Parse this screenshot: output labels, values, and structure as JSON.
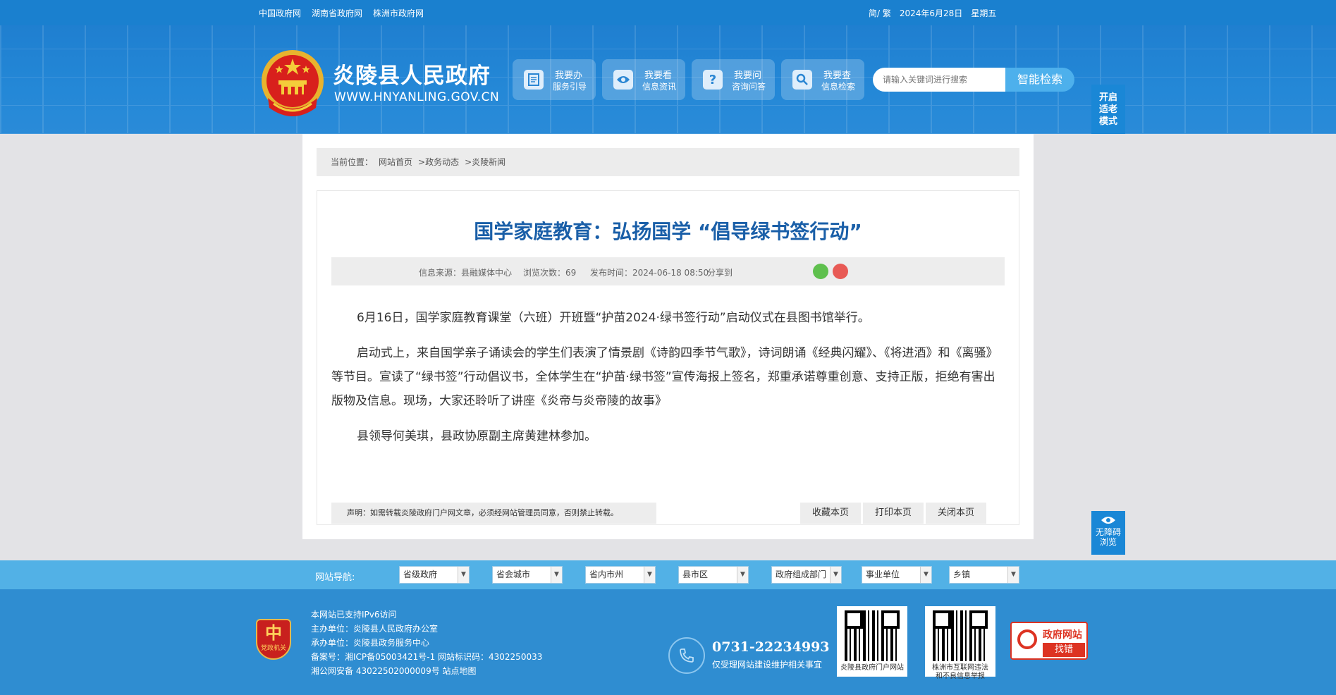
{
  "topbar": {
    "links": [
      "中国政府网",
      "湖南省政府网",
      "株洲市政府网"
    ],
    "lang": "简/ 繁",
    "date": "2024年6月28日",
    "weekday": "星期五"
  },
  "header": {
    "site_title": "炎陵县人民政府",
    "site_url": "WWW.HNYANLING.GOV.CN",
    "nav_buttons": [
      {
        "line1": "我要办",
        "line2": "服务引导",
        "icon": "document-icon"
      },
      {
        "line1": "我要看",
        "line2": "信息资讯",
        "icon": "eye-icon"
      },
      {
        "line1": "我要问",
        "line2": "咨询问答",
        "icon": "question-icon"
      },
      {
        "line1": "我要查",
        "line2": "信息检索",
        "icon": "search-icon"
      }
    ],
    "search_placeholder": "请输入关键词进行搜索",
    "search_button": "智能检索"
  },
  "side": {
    "elder_mode": [
      "开启",
      "适老",
      "模式"
    ],
    "accessibility": [
      "无障碍",
      "浏览"
    ]
  },
  "breadcrumb": {
    "label": "当前位置：",
    "items": [
      "网站首页",
      ">政务动态",
      ">炎陵新闻"
    ]
  },
  "article": {
    "title": "国学家庭教育：弘扬国学 “倡导绿书签行动”",
    "source": "信息来源：县融媒体中心",
    "views": "浏览次数：69",
    "published": "发布时间：2024-06-18 08:50",
    "share": "分享到",
    "paragraphs": [
      "6月16日，国学家庭教育课堂（六班）开班暨“护苗2024·绿书签行动”启动仪式在县图书馆举行。",
      "启动式上，来自国学亲子诵读会的学生们表演了情景剧《诗韵四季节气歌》，诗词朗诵《经典闪耀》、《将进酒》和《离骚》等节目。宣读了“绿书签”行动倡议书，全体学生在“护苗·绿书签”宣传海报上签名，郑重承诺尊重创意、支持正版，拒绝有害出版物及信息。现场，大家还聆听了讲座《炎帝与炎帝陵的故事》",
      "县领导何美琪，县政协原副主席黄建林参加。"
    ],
    "disclaimer": "声明：如需转载炎陵政府门户网文章，必须经网站管理员同意，否则禁止转载。",
    "tools": [
      "收藏本页",
      "打印本页",
      "关闭本页"
    ]
  },
  "sitenav": {
    "label": "网站导航:",
    "selects": [
      "省级政府",
      "省会城市",
      "省内市州",
      "县市区",
      "政府组成部门",
      "事业单位",
      "乡镇"
    ]
  },
  "footer": {
    "badge": "党政机关",
    "info": [
      "本网站已支持IPv6访问",
      "主办单位：炎陵县人民政府办公室",
      "承办单位：炎陵县政务服务中心",
      "备案号：湘ICP备05003421号-1 网站标识码：4302250033",
      "湘公网安备 43022502000009号 站点地图"
    ],
    "phone": "0731-22234993",
    "phone_desc": "仅受理网站建设维护相关事宜",
    "qr1_caption": "炎陵县政府门户网站",
    "qr2_caption": [
      "株洲市互联网违法",
      "和不良信息举报"
    ],
    "report": {
      "line1": "政府网站",
      "line2": "找错"
    }
  }
}
